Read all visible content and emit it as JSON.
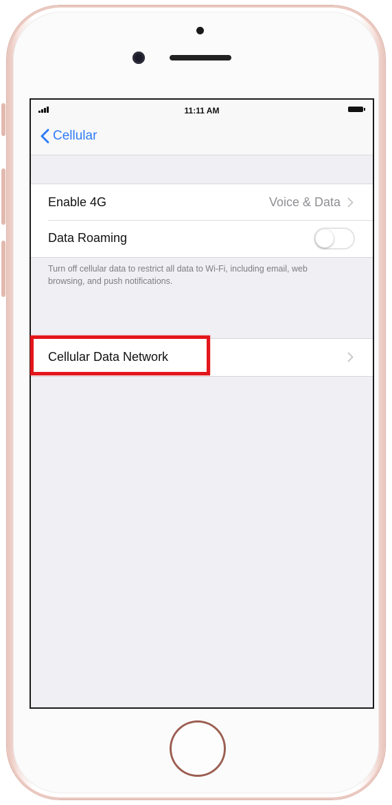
{
  "status_bar": {
    "time": "11:11 AM"
  },
  "nav": {
    "back_label": "Cellular"
  },
  "settings": {
    "enable_4g": {
      "label": "Enable 4G",
      "value": "Voice & Data"
    },
    "data_roaming": {
      "label": "Data Roaming",
      "enabled": false
    },
    "footnote": "Turn off cellular data to restrict all data to Wi-Fi, including email, web browsing, and push notifications.",
    "cellular_data_network": {
      "label": "Cellular Data Network"
    }
  },
  "colors": {
    "accent": "#2f7cf6",
    "highlight": "#e3161b",
    "background": "#efeff4",
    "secondary_text": "#8e8e93"
  },
  "icons": [
    "signal-icon",
    "battery-icon",
    "back-chevron-icon",
    "chevron-right-icon"
  ]
}
